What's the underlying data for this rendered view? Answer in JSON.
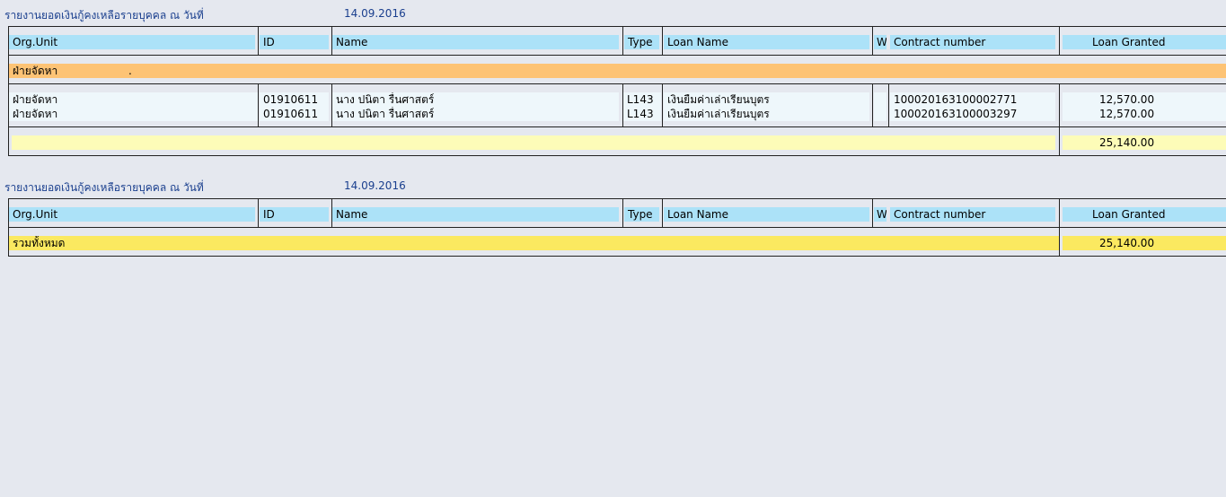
{
  "reports": [
    {
      "title": "รายงานยอดเงินกู้คงเหลือรายบุคคล ณ วันที่",
      "date": "14.09.2016",
      "columns": {
        "org_unit": "Org.Unit",
        "id": "ID",
        "name": "Name",
        "type": "Type",
        "loan_name": "Loan Name",
        "w": "W",
        "contract_number": "Contract number",
        "loan_granted": "Loan Granted"
      },
      "group": {
        "label": "ฝ่ายจัดหา",
        "marker": "."
      },
      "rows": [
        {
          "org_unit": "ฝ่ายจัดหา",
          "id": "01910611",
          "name": "นาง ปนิตา รื่นศาสตร์",
          "type": "L143",
          "loan_name": "เงินยืมค่าเล่าเรียนบุตร",
          "contract_number": "100020163100002771",
          "loan_granted": "12,570.00"
        },
        {
          "org_unit": "ฝ่ายจัดหา",
          "id": "01910611",
          "name": "นาง ปนิตา รื่นศาสตร์",
          "type": "L143",
          "loan_name": "เงินยืมค่าเล่าเรียนบุตร",
          "contract_number": "100020163100003297",
          "loan_granted": "12,570.00"
        }
      ],
      "subtotal": "25,140.00"
    },
    {
      "title": "รายงานยอดเงินกู้คงเหลือรายบุคคล ณ วันที่",
      "date": "14.09.2016",
      "columns": {
        "org_unit": "Org.Unit",
        "id": "ID",
        "name": "Name",
        "type": "Type",
        "loan_name": "Loan Name",
        "w": "W",
        "contract_number": "Contract number",
        "loan_granted": "Loan Granted"
      },
      "total_label": "รวมทั้งหมด",
      "total": "25,140.00"
    }
  ],
  "colors": {
    "background": "#e5e8ef",
    "header_cell": "#ace2f8",
    "group_row": "#fdc375",
    "subtotal_row": "#fdfcb8",
    "total_row": "#fbe960",
    "title_text": "#1a3f8e"
  }
}
